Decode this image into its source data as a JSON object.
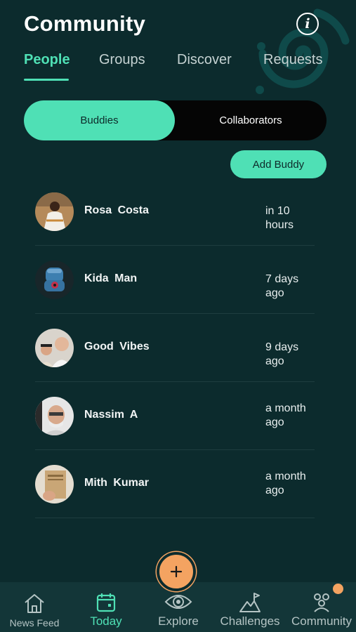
{
  "header": {
    "title": "Community",
    "info_icon": "info-icon"
  },
  "tabs": [
    {
      "label": "People",
      "active": true
    },
    {
      "label": "Groups",
      "active": false
    },
    {
      "label": "Discover",
      "active": false
    },
    {
      "label": "Requests",
      "active": false
    }
  ],
  "segment": {
    "left": "Buddies",
    "right": "Collaborators",
    "selected": "Buddies"
  },
  "actions": {
    "add_buddy": "Add Buddy"
  },
  "buddies": [
    {
      "name": "Rosa  Costa",
      "time": "in 10 hours"
    },
    {
      "name": "Kida  Man",
      "time": "7 days ago"
    },
    {
      "name": "Good  Vibes",
      "time": "9 days ago"
    },
    {
      "name": "Nassim  A",
      "time": "a month ago"
    },
    {
      "name": "Mith  Kumar",
      "time": "a month ago"
    }
  ],
  "nav": {
    "items": [
      {
        "label": "News Feed",
        "icon": "home-icon",
        "active": false
      },
      {
        "label": "Today",
        "icon": "calendar-icon",
        "active": true
      },
      {
        "label": "Explore",
        "icon": "eye-icon",
        "active": false
      },
      {
        "label": "Challenges",
        "icon": "mountain-flag-icon",
        "active": false
      },
      {
        "label": "Community",
        "icon": "people-icon",
        "active": false
      }
    ],
    "fab_icon": "plus-icon"
  },
  "colors": {
    "background": "#0c2b2d",
    "accent": "#4fe0b5",
    "orange": "#f4a361",
    "navbar": "#133638"
  }
}
